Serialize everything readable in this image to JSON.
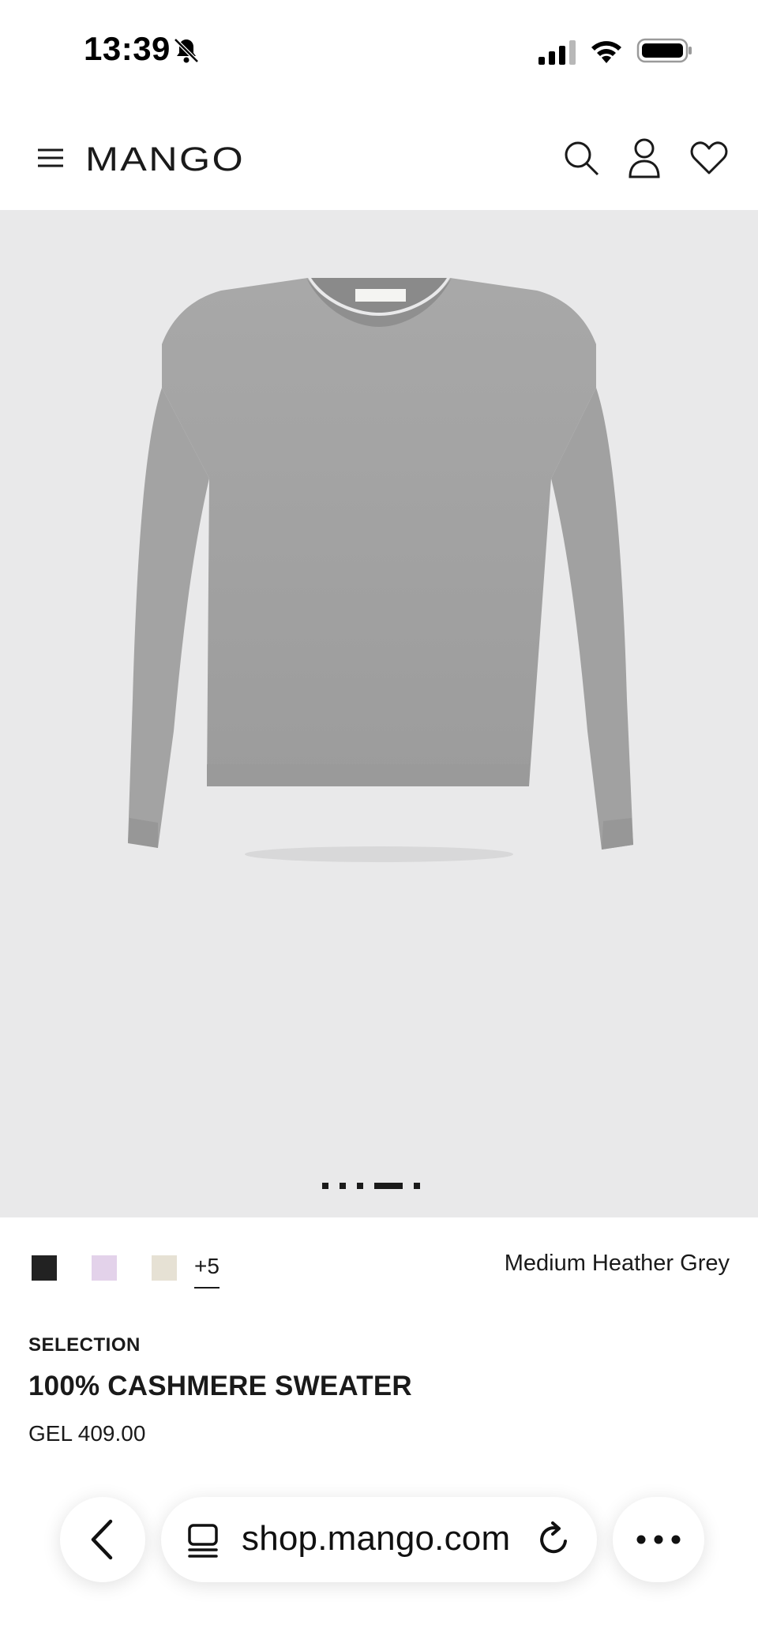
{
  "status_bar": {
    "time": "13:39",
    "icons": [
      "bell-slash-icon",
      "cellular-signal-icon",
      "wifi-icon",
      "battery-icon"
    ]
  },
  "header": {
    "brand": "MANGO",
    "icons": [
      "menu-icon",
      "search-icon",
      "account-icon",
      "wishlist-heart-icon"
    ]
  },
  "gallery": {
    "image": "grey-crewneck-sweater",
    "dots_total": 5,
    "active_dot": 4
  },
  "colors": {
    "swatches": [
      {
        "name": "black",
        "hex": "#222222"
      },
      {
        "name": "lilac",
        "hex": "#e3d2ea"
      },
      {
        "name": "beige",
        "hex": "#e6e1d4"
      }
    ],
    "more": "+5",
    "selected": "Medium Heather Grey"
  },
  "product": {
    "collection": "SELECTION",
    "name": "100% CASHMERE SWEATER",
    "price": "GEL 409.00"
  },
  "browser": {
    "url": "shop.mango.com",
    "icons": [
      "back-chevron-icon",
      "tabs-icon",
      "reload-icon",
      "more-dots-icon"
    ]
  }
}
